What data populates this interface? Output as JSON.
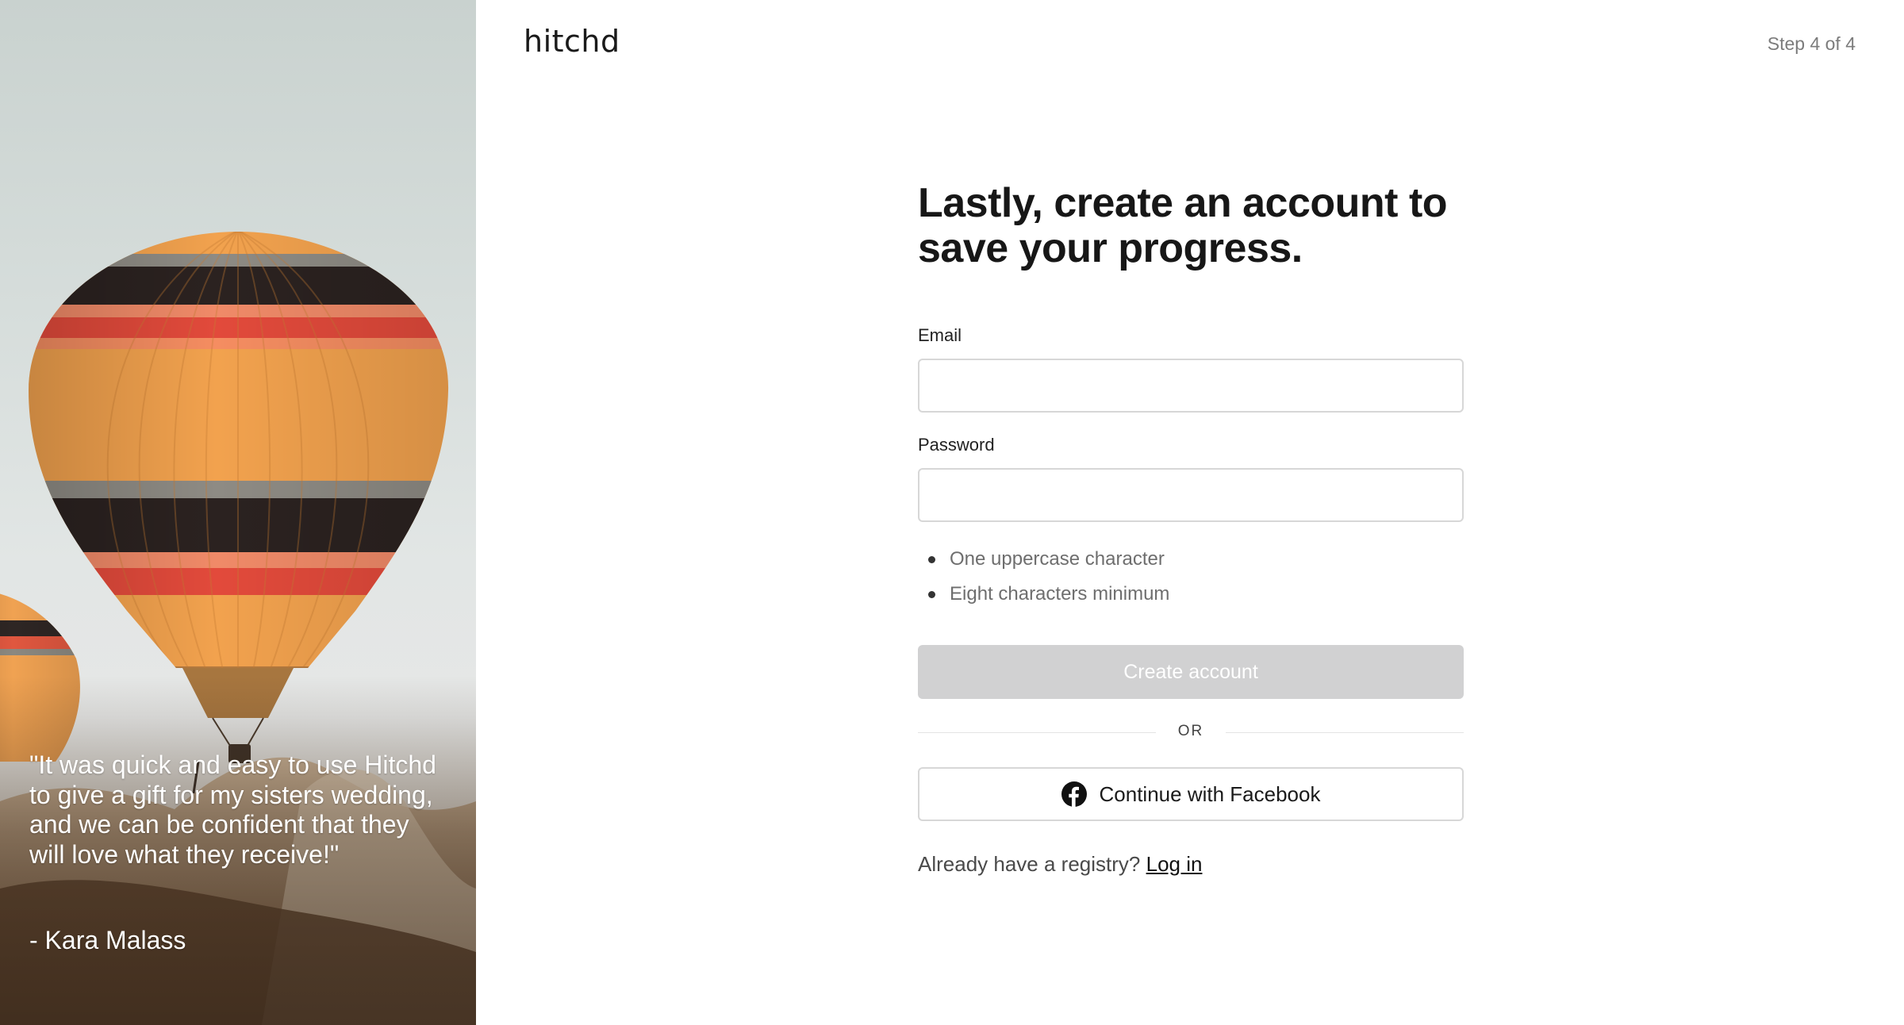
{
  "brand": {
    "logo_text": "hitchd"
  },
  "header": {
    "step": "Step 4 of 4"
  },
  "hero": {
    "quote": "\"It was quick and easy to use Hitchd to give a gift for my sisters wedding, and we can be confident that they will love what they receive!\"",
    "author": "- Kara Malass",
    "balloon_colors": {
      "orange": "#f2a24e",
      "red": "#e24a3b",
      "dark": "#2b2220",
      "grey": "#8e8b84"
    }
  },
  "form": {
    "title": "Lastly, create an account to save your progress.",
    "email_label": "Email",
    "email_value": "",
    "password_label": "Password",
    "password_value": "",
    "password_rules": [
      "One uppercase character",
      "Eight characters minimum"
    ],
    "create_button": "Create account",
    "divider_text": "OR",
    "facebook_button": "Continue with Facebook",
    "login_prompt": "Already have a registry?",
    "login_link": "Log in"
  },
  "colors": {
    "disabled_button": "#d1d1d2",
    "input_border": "#d7d7d7",
    "text": "#1a1a1a"
  },
  "icons": {
    "facebook": "facebook-icon",
    "bullet": "bullet-dot"
  }
}
